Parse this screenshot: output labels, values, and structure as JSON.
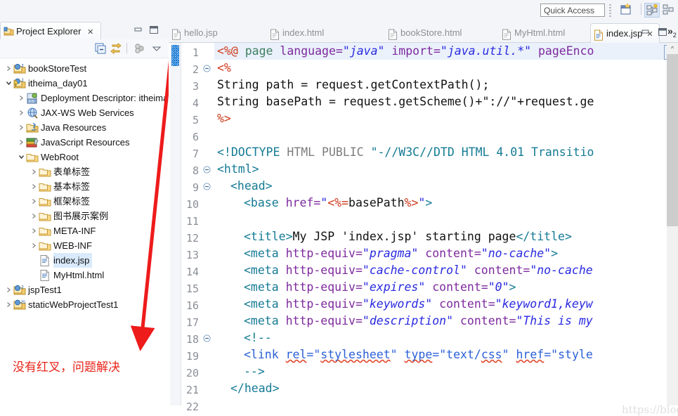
{
  "toolbar": {
    "quick_access_placeholder": "Quick Access",
    "buttons": [
      {
        "name": "new-perspective-icon",
        "label": ""
      },
      {
        "name": "java-ee-perspective-icon",
        "label": ""
      }
    ]
  },
  "explorer": {
    "tab_label": "Project Explorer",
    "tab_close": "✕",
    "view_icon": "project-explorer-icon",
    "minimize_label": "▬",
    "maximize_label": "❐",
    "toolbar_icons": [
      "collapse-all-icon",
      "link-with-editor-icon",
      "view-menu-icon",
      "view-dropdown-icon"
    ],
    "tree": [
      {
        "label": "bookStoreTest",
        "indent": 0,
        "twisty": "collapsed",
        "icon": "java-project-icon",
        "selected": false
      },
      {
        "label": "itheima_day01",
        "indent": 0,
        "twisty": "expanded",
        "icon": "java-project-warn-icon",
        "selected": false
      },
      {
        "label": "Deployment Descriptor: itheima",
        "indent": 1,
        "twisty": "collapsed",
        "icon": "deployment-descriptor-icon",
        "selected": false
      },
      {
        "label": "JAX-WS Web Services",
        "indent": 1,
        "twisty": "collapsed",
        "icon": "jaxws-icon",
        "selected": false
      },
      {
        "label": "Java Resources",
        "indent": 1,
        "twisty": "collapsed",
        "icon": "java-resources-icon",
        "selected": false
      },
      {
        "label": "JavaScript Resources",
        "indent": 1,
        "twisty": "collapsed",
        "icon": "javascript-resources-icon",
        "selected": false
      },
      {
        "label": "WebRoot",
        "indent": 1,
        "twisty": "expanded",
        "icon": "folder-icon",
        "selected": false
      },
      {
        "label": "表单标签",
        "indent": 2,
        "twisty": "collapsed",
        "icon": "folder-icon",
        "selected": false
      },
      {
        "label": "基本标签",
        "indent": 2,
        "twisty": "collapsed",
        "icon": "folder-icon",
        "selected": false
      },
      {
        "label": "框架标签",
        "indent": 2,
        "twisty": "collapsed",
        "icon": "folder-icon",
        "selected": false
      },
      {
        "label": "图书展示案例",
        "indent": 2,
        "twisty": "collapsed",
        "icon": "folder-icon",
        "selected": false
      },
      {
        "label": "META-INF",
        "indent": 2,
        "twisty": "collapsed",
        "icon": "folder-icon",
        "selected": false
      },
      {
        "label": "WEB-INF",
        "indent": 2,
        "twisty": "collapsed",
        "icon": "folder-icon",
        "selected": false
      },
      {
        "label": "index.jsp",
        "indent": 2,
        "twisty": "none",
        "icon": "jsp-file-icon",
        "selected": true
      },
      {
        "label": "MyHtml.html",
        "indent": 2,
        "twisty": "none",
        "icon": "html-file-icon",
        "selected": false
      },
      {
        "label": "jspTest1",
        "indent": 0,
        "twisty": "collapsed",
        "icon": "java-project-icon",
        "selected": false
      },
      {
        "label": "staticWebProjectTest1",
        "indent": 0,
        "twisty": "collapsed",
        "icon": "web-project-icon",
        "selected": false
      }
    ]
  },
  "annotation": {
    "text": "没有红叉，问题解决",
    "color": "#e8241a",
    "arrow_name": "red-arrow",
    "highlight_rect_name": "red-highlight-rectangle"
  },
  "editor": {
    "tabs": [
      {
        "label": "hello.jsp",
        "active": false,
        "icon": "jsp-file-icon",
        "close": ""
      },
      {
        "label": "index.html",
        "active": false,
        "icon": "html-file-icon",
        "close": ""
      },
      {
        "label": "bookStore.html",
        "active": false,
        "icon": "html-file-icon",
        "close": ""
      },
      {
        "label": "MyHtml.html",
        "active": false,
        "icon": "html-file-icon",
        "close": ""
      },
      {
        "label": "index.jsp",
        "active": true,
        "icon": "jsp-file-icon",
        "close": "✕"
      }
    ],
    "overflow_label": "»",
    "overflow_count": "2",
    "minimize_label": "▬",
    "maximize_label": "❐",
    "scroll_up_label": "^",
    "watermark": "https://blog.csdn.net/AriesTina",
    "current_line": 1,
    "lines": [
      {
        "n": 1,
        "fold": "",
        "current": true
      },
      {
        "n": 2,
        "fold": "⊖",
        "current": false
      },
      {
        "n": 3,
        "fold": "",
        "current": false
      },
      {
        "n": 4,
        "fold": "",
        "current": false
      },
      {
        "n": 5,
        "fold": "",
        "current": false
      },
      {
        "n": 6,
        "fold": "",
        "current": false
      },
      {
        "n": 7,
        "fold": "",
        "current": false
      },
      {
        "n": 8,
        "fold": "⊖",
        "current": false
      },
      {
        "n": 9,
        "fold": "⊖",
        "current": false
      },
      {
        "n": 10,
        "fold": "",
        "current": false
      },
      {
        "n": 11,
        "fold": "",
        "current": false
      },
      {
        "n": 12,
        "fold": "",
        "current": false
      },
      {
        "n": 13,
        "fold": "",
        "current": false
      },
      {
        "n": 14,
        "fold": "",
        "current": false
      },
      {
        "n": 15,
        "fold": "",
        "current": false
      },
      {
        "n": 16,
        "fold": "",
        "current": false
      },
      {
        "n": 17,
        "fold": "",
        "current": false
      },
      {
        "n": 18,
        "fold": "⊖",
        "current": false
      },
      {
        "n": 19,
        "fold": "",
        "current": false
      },
      {
        "n": 20,
        "fold": "",
        "current": false
      },
      {
        "n": 21,
        "fold": "",
        "current": false
      },
      {
        "n": 22,
        "fold": "",
        "current": false
      }
    ],
    "code": [
      {
        "line": 1,
        "indent": 0,
        "tokens": [
          {
            "t": "<%@ ",
            "c": "t-jsp"
          },
          {
            "t": "page ",
            "c": "t-kw"
          },
          {
            "t": "language=",
            "c": "t-attr"
          },
          {
            "t": "\"java\"",
            "c": "t-val"
          },
          {
            "t": " import=",
            "c": "t-attr"
          },
          {
            "t": "\"java.util.*\"",
            "c": "t-val"
          },
          {
            "t": " pageEnco",
            "c": "t-attr"
          }
        ]
      },
      {
        "line": 2,
        "indent": 0,
        "tokens": [
          {
            "t": "<%",
            "c": "t-jsp"
          }
        ]
      },
      {
        "line": 3,
        "indent": 0,
        "tokens": [
          {
            "t": "String path = request.getContextPath();",
            "c": "t-code"
          }
        ]
      },
      {
        "line": 4,
        "indent": 0,
        "tokens": [
          {
            "t": "String basePath = request.getScheme()+\"://\"+request.ge",
            "c": "t-code"
          }
        ]
      },
      {
        "line": 5,
        "indent": 0,
        "tokens": [
          {
            "t": "%>",
            "c": "t-jsp"
          }
        ]
      },
      {
        "line": 6,
        "indent": 0,
        "tokens": []
      },
      {
        "line": 7,
        "indent": 0,
        "tokens": [
          {
            "t": "<!DOCTYPE ",
            "c": "t-cmt"
          },
          {
            "t": "HTML PUBLIC ",
            "c": "t-gray"
          },
          {
            "t": "\"-//W3C//DTD HTML 4.01 Transitio",
            "c": "t-cmt"
          }
        ]
      },
      {
        "line": 8,
        "indent": 0,
        "tokens": [
          {
            "t": "<html>",
            "c": "t-tag"
          }
        ]
      },
      {
        "line": 9,
        "indent": 1,
        "tokens": [
          {
            "t": "<head>",
            "c": "t-tag"
          }
        ]
      },
      {
        "line": 10,
        "indent": 2,
        "tokens": [
          {
            "t": "<base ",
            "c": "t-tag"
          },
          {
            "t": "href=",
            "c": "t-attr"
          },
          {
            "t": "\"",
            "c": "t-valp"
          },
          {
            "t": "<%=",
            "c": "t-jsp"
          },
          {
            "t": "basePath",
            "c": "t-code"
          },
          {
            "t": "%>",
            "c": "t-jsp"
          },
          {
            "t": "\"",
            "c": "t-valp"
          },
          {
            "t": ">",
            "c": "t-tag"
          }
        ]
      },
      {
        "line": 11,
        "indent": 0,
        "tokens": []
      },
      {
        "line": 12,
        "indent": 2,
        "tokens": [
          {
            "t": "<title>",
            "c": "t-tag"
          },
          {
            "t": "My JSP 'index.jsp' starting page",
            "c": "t-txt"
          },
          {
            "t": "</title>",
            "c": "t-tag"
          }
        ]
      },
      {
        "line": 13,
        "indent": 2,
        "tokens": [
          {
            "t": "<meta ",
            "c": "t-tag"
          },
          {
            "t": "http-equiv=",
            "c": "t-attr"
          },
          {
            "t": "\"pragma\"",
            "c": "t-val"
          },
          {
            "t": " content=",
            "c": "t-attr"
          },
          {
            "t": "\"no-cache\"",
            "c": "t-val"
          },
          {
            "t": ">",
            "c": "t-tag"
          }
        ]
      },
      {
        "line": 14,
        "indent": 2,
        "tokens": [
          {
            "t": "<meta ",
            "c": "t-tag"
          },
          {
            "t": "http-equiv=",
            "c": "t-attr"
          },
          {
            "t": "\"cache-control\"",
            "c": "t-val"
          },
          {
            "t": " content=",
            "c": "t-attr"
          },
          {
            "t": "\"no-cache",
            "c": "t-val"
          }
        ]
      },
      {
        "line": 15,
        "indent": 2,
        "tokens": [
          {
            "t": "<meta ",
            "c": "t-tag"
          },
          {
            "t": "http-equiv=",
            "c": "t-attr"
          },
          {
            "t": "\"expires\"",
            "c": "t-val"
          },
          {
            "t": " content=",
            "c": "t-attr"
          },
          {
            "t": "\"0\"",
            "c": "t-val"
          },
          {
            "t": ">",
            "c": "t-tag"
          }
        ]
      },
      {
        "line": 16,
        "indent": 2,
        "tokens": [
          {
            "t": "<meta ",
            "c": "t-tag"
          },
          {
            "t": "http-equiv=",
            "c": "t-attr"
          },
          {
            "t": "\"keywords\"",
            "c": "t-val"
          },
          {
            "t": " content=",
            "c": "t-attr"
          },
          {
            "t": "\"keyword1,keyw",
            "c": "t-val"
          }
        ]
      },
      {
        "line": 17,
        "indent": 2,
        "tokens": [
          {
            "t": "<meta ",
            "c": "t-tag"
          },
          {
            "t": "http-equiv=",
            "c": "t-attr"
          },
          {
            "t": "\"description\"",
            "c": "t-val"
          },
          {
            "t": " content=",
            "c": "t-attr"
          },
          {
            "t": "\"This is my",
            "c": "t-val"
          }
        ]
      },
      {
        "line": 18,
        "indent": 2,
        "tokens": [
          {
            "t": "<!--",
            "c": "t-tag"
          }
        ]
      },
      {
        "line": 19,
        "indent": 2,
        "tokens": [
          {
            "t": "<link ",
            "c": "t-link"
          },
          {
            "t": "rel",
            "c": "t-link sq"
          },
          {
            "t": "=\"",
            "c": "t-link"
          },
          {
            "t": "stylesheet",
            "c": "t-link sq"
          },
          {
            "t": "\" ",
            "c": "t-link"
          },
          {
            "t": "type",
            "c": "t-link sq"
          },
          {
            "t": "=\"",
            "c": "t-link"
          },
          {
            "t": "text/",
            "c": "t-link"
          },
          {
            "t": "css",
            "c": "t-link sq"
          },
          {
            "t": "\" ",
            "c": "t-link"
          },
          {
            "t": "href",
            "c": "t-link sq"
          },
          {
            "t": "=\"style",
            "c": "t-link"
          }
        ]
      },
      {
        "line": 20,
        "indent": 2,
        "tokens": [
          {
            "t": "-->",
            "c": "t-tag"
          }
        ]
      },
      {
        "line": 21,
        "indent": 1,
        "tokens": [
          {
            "t": "</head>",
            "c": "t-tag"
          }
        ]
      },
      {
        "line": 22,
        "indent": 0,
        "tokens": []
      }
    ]
  }
}
